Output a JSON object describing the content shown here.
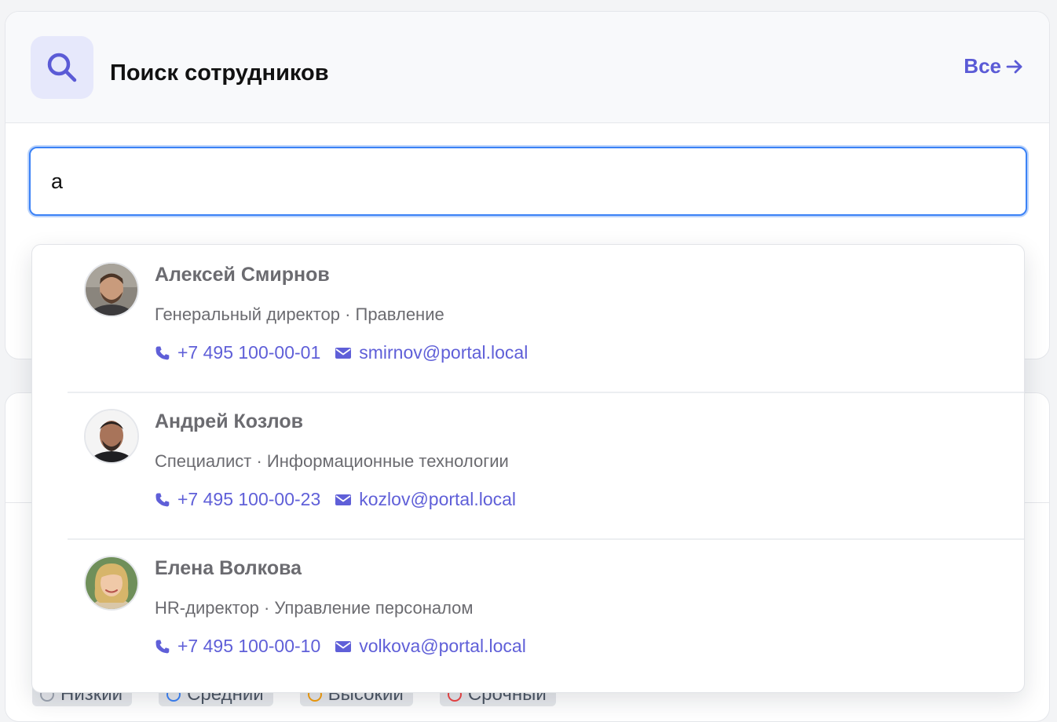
{
  "header": {
    "title": "Поиск сотрудников",
    "all_link": "Все"
  },
  "search": {
    "value": "а"
  },
  "priorities": [
    "Низкий",
    "Средний",
    "Высокий",
    "Срочный"
  ],
  "results": [
    {
      "name": "Алексей Смирнов",
      "role": "Генеральный директор · Правление",
      "phone": "+7 495 100-00-01",
      "email": "smirnov@portal.local"
    },
    {
      "name": "Андрей Козлов",
      "role": "Специалист · Информационные технологии",
      "phone": "+7 495 100-00-23",
      "email": "kozlov@portal.local"
    },
    {
      "name": "Елена Волкова",
      "role": "HR-директор · Управление персоналом",
      "phone": "+7 495 100-00-10",
      "email": "volkova@portal.local"
    }
  ],
  "colors": {
    "accent": "#5b5bd6",
    "focus_ring": "#3b82f6"
  }
}
